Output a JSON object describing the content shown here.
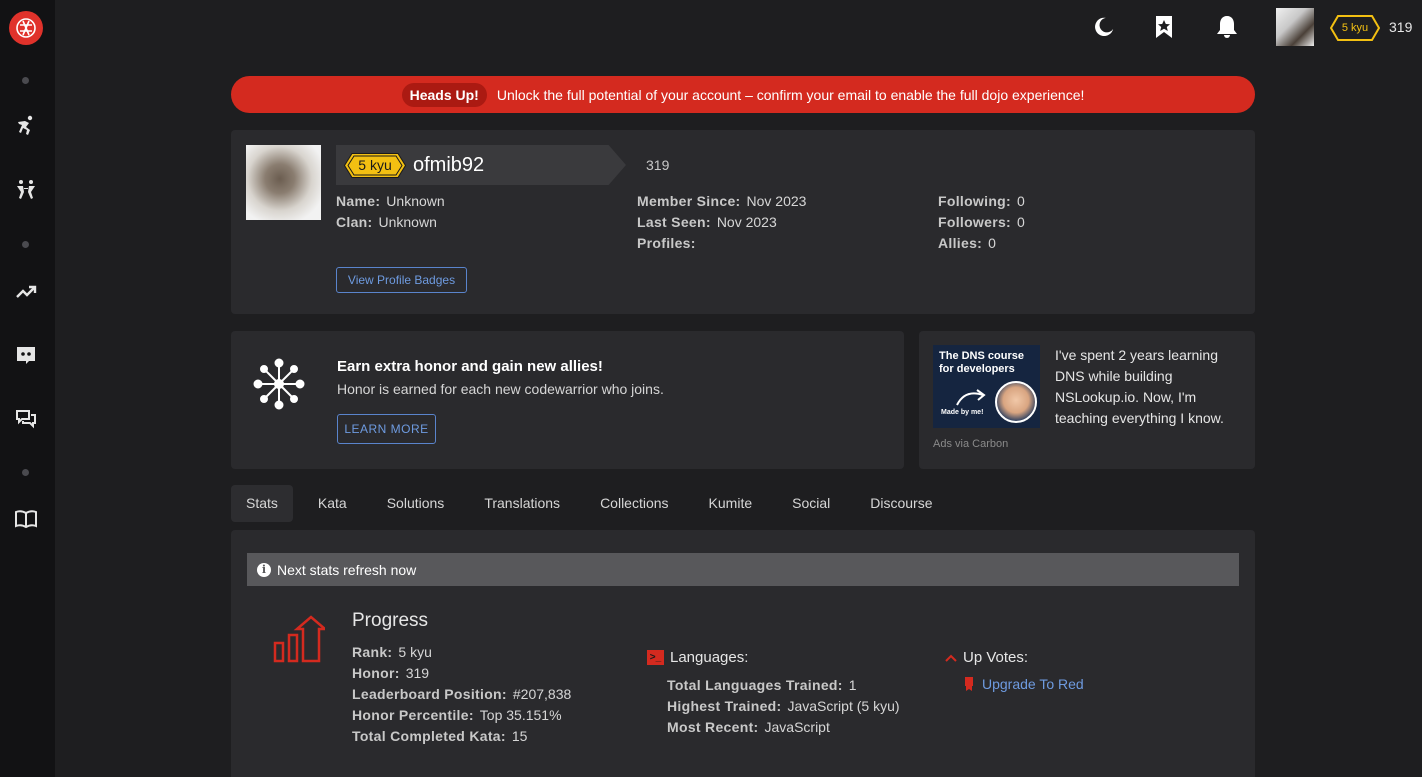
{
  "topbar": {
    "rank": "5 kyu",
    "honor": "319"
  },
  "alert": {
    "tag": "Heads Up!",
    "text": "Unlock the full potential of your account – confirm your email to enable the full dojo experience!"
  },
  "profile": {
    "rank": "5 kyu",
    "username": "ofmib92",
    "honor": "319",
    "col1": [
      {
        "k": "Name:",
        "v": "Unknown"
      },
      {
        "k": "Clan:",
        "v": "Unknown"
      }
    ],
    "col2": [
      {
        "k": "Member Since:",
        "v": "Nov 2023"
      },
      {
        "k": "Last Seen:",
        "v": "Nov 2023"
      },
      {
        "k": "Profiles:",
        "v": ""
      }
    ],
    "col3": [
      {
        "k": "Following:",
        "v": "0"
      },
      {
        "k": "Followers:",
        "v": "0"
      },
      {
        "k": "Allies:",
        "v": "0"
      }
    ],
    "badges_button": "View Profile Badges"
  },
  "promo": {
    "title": "Earn extra honor and gain new allies!",
    "subtitle": "Honor is earned for each new codewarrior who joins.",
    "button": "LEARN MORE"
  },
  "ad": {
    "image_title": "The DNS course for developers",
    "image_caption": "Made by me!",
    "text": "I've spent 2 years learning DNS while building NSLookup.io. Now, I'm teaching everything I know.",
    "via": "Ads via Carbon"
  },
  "tabs": [
    {
      "label": "Stats",
      "active": true
    },
    {
      "label": "Kata"
    },
    {
      "label": "Solutions"
    },
    {
      "label": "Translations"
    },
    {
      "label": "Collections"
    },
    {
      "label": "Kumite"
    },
    {
      "label": "Social"
    },
    {
      "label": "Discourse"
    }
  ],
  "stats": {
    "refresh": "Next stats refresh now",
    "progress_title": "Progress",
    "progress": [
      {
        "k": "Rank:",
        "v": "5 kyu"
      },
      {
        "k": "Honor:",
        "v": "319"
      },
      {
        "k": "Leaderboard Position:",
        "v": "#207,838"
      },
      {
        "k": "Honor Percentile:",
        "v": "Top 35.151%"
      },
      {
        "k": "Total Completed Kata:",
        "v": "15"
      }
    ],
    "languages_title": "Languages:",
    "languages": [
      {
        "k": "Total Languages Trained:",
        "v": "1"
      },
      {
        "k": "Highest Trained:",
        "v": "JavaScript (5 kyu)"
      },
      {
        "k": "Most Recent:",
        "v": "JavaScript"
      }
    ],
    "upvotes_title": "Up Votes:",
    "upgrade_link": "Upgrade To Red"
  },
  "colors": {
    "accent_red": "#d42a1f",
    "rank_yellow": "#f3c012",
    "link_blue": "#6e9be0"
  }
}
